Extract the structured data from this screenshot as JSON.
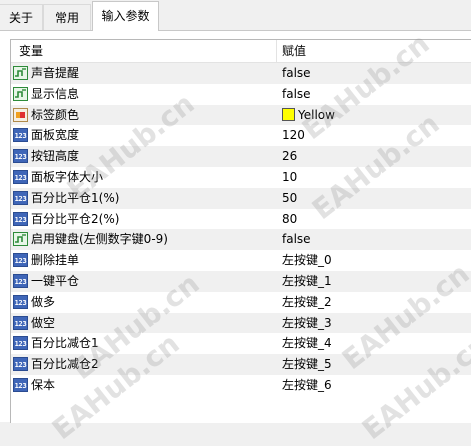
{
  "tabs": [
    "关于",
    "常用",
    "输入参数"
  ],
  "grid": {
    "col_variable": "变量",
    "col_value": "赋值"
  },
  "rows": [
    {
      "name": "声音提醒",
      "value": "false",
      "type": "bool"
    },
    {
      "name": "显示信息",
      "value": "false",
      "type": "bool"
    },
    {
      "name": "标签颜色",
      "value": "Yellow",
      "type": "color",
      "color": "#ffff00"
    },
    {
      "name": "面板宽度",
      "value": "120",
      "type": "number"
    },
    {
      "name": "按钮高度",
      "value": "26",
      "type": "number"
    },
    {
      "name": "面板字体大小",
      "value": "10",
      "type": "number"
    },
    {
      "name": "百分比平仓1(%)",
      "value": "50",
      "type": "number"
    },
    {
      "name": "百分比平仓2(%)",
      "value": "80",
      "type": "number"
    },
    {
      "name": "启用键盘(左侧数字键0-9)",
      "value": "false",
      "type": "bool"
    },
    {
      "name": "删除挂单",
      "value": "左按键_0",
      "type": "number"
    },
    {
      "name": "一键平仓",
      "value": "左按键_1",
      "type": "number"
    },
    {
      "name": "做多",
      "value": "左按键_2",
      "type": "number"
    },
    {
      "name": "做空",
      "value": "左按键_3",
      "type": "number"
    },
    {
      "name": "百分比减仓1",
      "value": "左按键_4",
      "type": "number"
    },
    {
      "name": "百分比减仓2",
      "value": "左按键_5",
      "type": "number"
    },
    {
      "name": "保本",
      "value": "左按键_6",
      "type": "number"
    }
  ],
  "icons": {
    "number": "123",
    "bool": "bool-icon",
    "color": "color-icon"
  },
  "watermark": "EAHub.cn"
}
